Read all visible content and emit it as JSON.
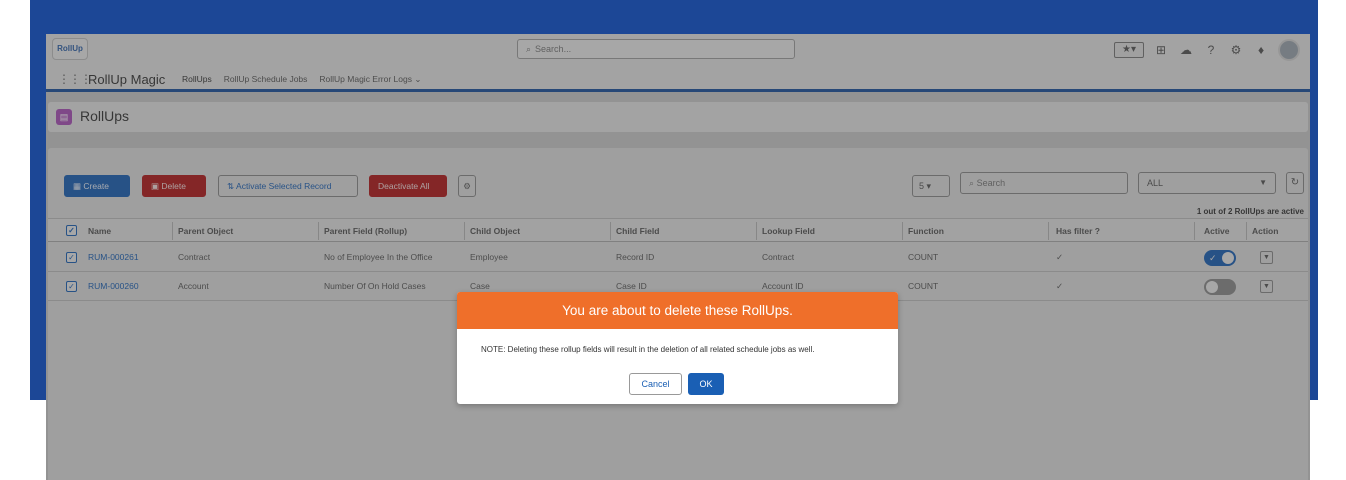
{
  "colors": {
    "brand_blue": "#1a5fb4",
    "page_blue": "#1c4796",
    "danger_red": "#b1191b",
    "modal_orange": "#ef6f2a"
  },
  "header": {
    "logo_text": "RollUp",
    "search_placeholder": "Search...",
    "icons": [
      "star-icon",
      "plus-icon",
      "cloud-icon",
      "help-icon",
      "gear-icon",
      "bell-icon",
      "avatar"
    ]
  },
  "nav": {
    "app_name": "RollUp Magic",
    "tabs": [
      {
        "label": "RollUps",
        "active": true
      },
      {
        "label": "RollUp Schedule Jobs",
        "active": false
      },
      {
        "label": "RollUp Magic Error Logs",
        "active": false
      }
    ]
  },
  "page": {
    "title": "RollUps"
  },
  "toolbar": {
    "create_label": "Create",
    "delete_label": "Delete",
    "activate_label": "Activate Selected Record",
    "deactivate_label": "Deactivate All",
    "page_size": "5",
    "search_placeholder": "Search",
    "filter_value": "ALL"
  },
  "summary": "1 out of 2 RollUps are active",
  "table": {
    "columns": [
      "Name",
      "Parent Object",
      "Parent Field (Rollup)",
      "Child Object",
      "Child Field",
      "Lookup Field",
      "Function",
      "Has filter ?",
      "Active",
      "Action"
    ],
    "rows": [
      {
        "name": "RUM-000261",
        "parent_object": "Contract",
        "parent_field": "No of Employee In the Office",
        "child_object": "Employee",
        "child_field": "Record ID",
        "lookup_field": "Contract",
        "function": "COUNT",
        "has_filter": true,
        "active": true
      },
      {
        "name": "RUM-000260",
        "parent_object": "Account",
        "parent_field": "Number Of On Hold Cases",
        "child_object": "Case",
        "child_field": "Case ID",
        "lookup_field": "Account ID",
        "function": "COUNT",
        "has_filter": true,
        "active": false
      }
    ]
  },
  "modal": {
    "title": "You are about to delete these RollUps.",
    "note": "NOTE: Deleting these rollup fields will result in the deletion of all related schedule jobs as well.",
    "cancel_label": "Cancel",
    "ok_label": "OK"
  }
}
